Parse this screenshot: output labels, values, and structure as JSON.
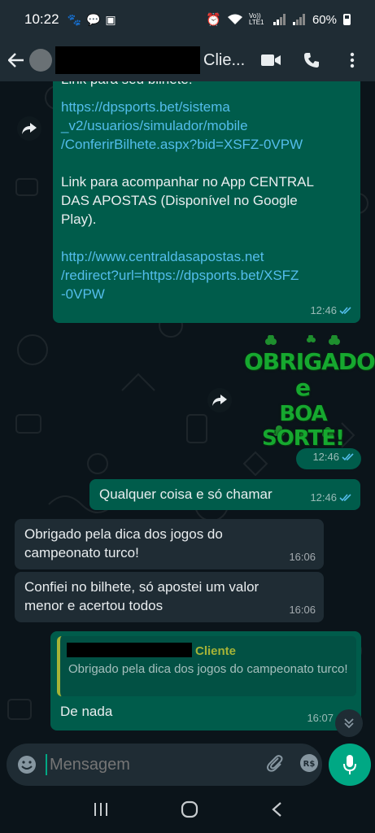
{
  "status_bar": {
    "time": "10:22",
    "network": "Vo)) LTE1",
    "battery": "60%"
  },
  "header": {
    "contact_name": "Clie..."
  },
  "messages": {
    "m1": {
      "partial_line": "Link para seu bilhete:",
      "link1_l1": "https://dpsports.bet/sistema",
      "link1_l2": "_v2/usuarios/simulador/mobile",
      "link1_l3": "/ConferirBilhete.aspx?bid=XSFZ-0VPW",
      "text2_l1": "Link para acompanhar no App CENTRAL",
      "text2_l2": "DAS APOSTAS (Disponível no Google",
      "text2_l3": "Play).",
      "link2_l1": "http://www.centraldasapostas.net",
      "link2_l2": "/redirect?url=https://dpsports.bet/XSFZ",
      "link2_l3": "-0VPW",
      "time": "12:46"
    },
    "sticker": {
      "line1": "OBRIGADO",
      "line2": "e",
      "line3": "BOA SORTE!",
      "time": "12:46"
    },
    "m3": {
      "text": "Qualquer coisa e só chamar",
      "time": "12:46"
    },
    "m4": {
      "line1": "Obrigado pela dica dos jogos do",
      "line2": "campeonato turco!",
      "time": "16:06"
    },
    "m5": {
      "line1": "Confiei no bilhete, só apostei um valor",
      "line2": "menor e acertou todos",
      "time": "16:06"
    },
    "m6": {
      "quote_name": "Cliente",
      "quote_text": "Obrigado pela dica dos jogos do campeonato turco!",
      "text": "De nada",
      "time": "16:07"
    }
  },
  "input": {
    "placeholder": "Mensagem"
  },
  "colors": {
    "outgoing_bubble": "#005c4b",
    "incoming_bubble": "#1f2c34",
    "link": "#53bdeb",
    "accent": "#00a884",
    "read_ticks": "#53bdeb"
  }
}
